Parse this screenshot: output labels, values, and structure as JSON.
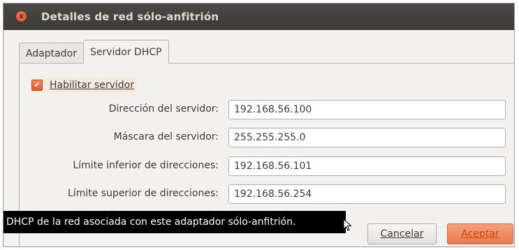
{
  "window": {
    "title": "Detalles de red sólo-anfitrión",
    "close_icon": "x"
  },
  "tabs": [
    {
      "label": "Adaptador",
      "active": false
    },
    {
      "label": "Servidor DHCP",
      "active": true
    }
  ],
  "dhcp": {
    "enable_checkbox": {
      "label": "Habilitar servidor",
      "checked": true
    },
    "fields": [
      {
        "label": "Dirección del servidor:",
        "value": "192.168.56.100"
      },
      {
        "label": "Máscara del servidor:",
        "value": "255.255.255.0"
      },
      {
        "label": "Límite inferior de direcciones:",
        "value": "192.168.56.101"
      },
      {
        "label": "Límite superior de direcciones:",
        "value": "192.168.56.254"
      }
    ]
  },
  "tooltip": {
    "text": "DHCP de la red asociada con este adaptador sólo-anfitrión."
  },
  "buttons": {
    "cancel": "Cancelar",
    "accept": "Aceptar"
  },
  "colors": {
    "accent": "#e8794f",
    "titlebar": "#3b3a36"
  }
}
